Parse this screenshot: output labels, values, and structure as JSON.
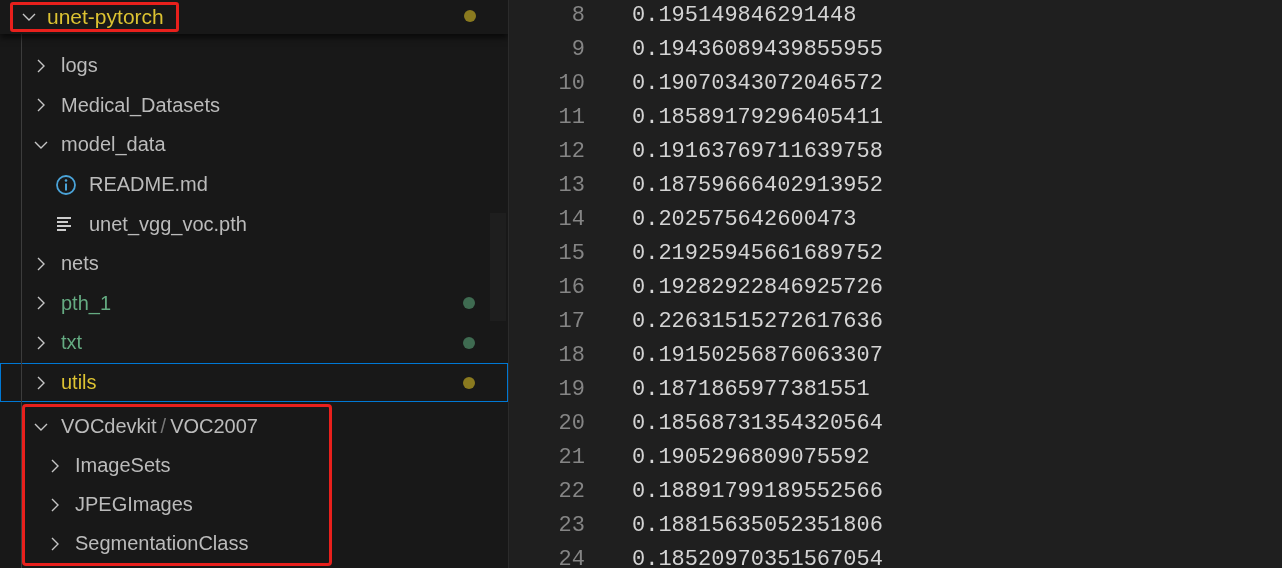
{
  "explorer": {
    "root": {
      "name": "unet-pytorch",
      "expanded": true,
      "color": "#8a7a1f",
      "annotated": true,
      "children": [
        {
          "name": "logs",
          "kind": "folder",
          "expanded": false,
          "selected": false
        },
        {
          "name": "Medical_Datasets",
          "kind": "folder",
          "expanded": false,
          "selected": false
        },
        {
          "name": "model_data",
          "kind": "folder",
          "expanded": true,
          "selected": false,
          "children": [
            {
              "name": "README.md",
              "kind": "info-file",
              "selected": false
            },
            {
              "name": "unet_vgg_voc.pth",
              "kind": "text-file",
              "selected": false
            }
          ]
        },
        {
          "name": "nets",
          "kind": "folder",
          "expanded": false,
          "selected": false
        },
        {
          "name": "pth_1",
          "kind": "folder",
          "expanded": false,
          "selected": false,
          "color": "#3f6b51"
        },
        {
          "name": "txt",
          "kind": "folder",
          "expanded": false,
          "selected": false,
          "color": "#3f6b51"
        },
        {
          "name": "utils",
          "kind": "folder",
          "expanded": false,
          "selected": true,
          "color": "#8a7a1f"
        },
        {
          "name": "VOCdevkit",
          "compact_child": "VOC2007",
          "separator": "/",
          "kind": "folder",
          "expanded": true,
          "selected": false,
          "annotated": true,
          "children": [
            {
              "name": "ImageSets",
              "kind": "folder",
              "expanded": false,
              "selected": false
            },
            {
              "name": "JPEGImages",
              "kind": "folder",
              "expanded": false,
              "selected": false
            },
            {
              "name": "SegmentationClass",
              "kind": "folder",
              "expanded": false,
              "selected": false
            }
          ]
        }
      ]
    }
  },
  "editor": {
    "lines": [
      {
        "number": "8",
        "text": "0.195149846291448"
      },
      {
        "number": "9",
        "text": "0.19436089439855955"
      },
      {
        "number": "10",
        "text": "0.19070343072046572"
      },
      {
        "number": "11",
        "text": "0.18589179296405411"
      },
      {
        "number": "12",
        "text": "0.19163769711639758"
      },
      {
        "number": "13",
        "text": "0.18759666402913952"
      },
      {
        "number": "14",
        "text": "0.202575642600473"
      },
      {
        "number": "15",
        "text": "0.21925945661689752"
      },
      {
        "number": "16",
        "text": "0.19282922846925726"
      },
      {
        "number": "17",
        "text": "0.22631515272617636"
      },
      {
        "number": "18",
        "text": "0.19150256876063307"
      },
      {
        "number": "19",
        "text": "0.1871865977381551"
      },
      {
        "number": "20",
        "text": "0.18568731354320564"
      },
      {
        "number": "21",
        "text": "0.1905296809075592"
      },
      {
        "number": "22",
        "text": "0.18891799189552566"
      },
      {
        "number": "23",
        "text": "0.18815635052351806"
      },
      {
        "number": "24",
        "text": "0.18520970351567054"
      }
    ]
  }
}
